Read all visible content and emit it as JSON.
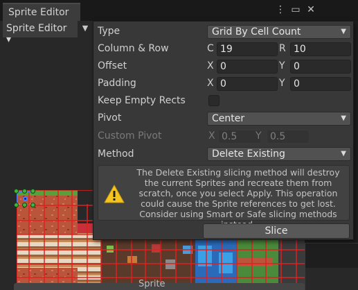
{
  "window": {
    "tab_title": "Sprite Editor"
  },
  "toolbar": {
    "mode_label": "Sprite Editor ▾"
  },
  "bottom": {
    "tab_label": "Sprite"
  },
  "slicing": {
    "type": {
      "label": "Type",
      "value": "Grid By Cell Count"
    },
    "column_row": {
      "label": "Column & Row",
      "c_label": "C",
      "c_value": "19",
      "r_label": "R",
      "r_value": "10"
    },
    "offset": {
      "label": "Offset",
      "x_label": "X",
      "x_value": "0",
      "y_label": "Y",
      "y_value": "0"
    },
    "padding": {
      "label": "Padding",
      "x_label": "X",
      "x_value": "0",
      "y_label": "Y",
      "y_value": "0"
    },
    "keep_empty": {
      "label": "Keep Empty Rects",
      "checked": false
    },
    "pivot": {
      "label": "Pivot",
      "value": "Center"
    },
    "custom_pivot": {
      "label": "Custom Pivot",
      "x_label": "X",
      "x_value": "0.5",
      "y_label": "Y",
      "y_value": "0.5"
    },
    "method": {
      "label": "Method",
      "value": "Delete Existing"
    },
    "help_text": "The Delete Existing slicing method will destroy the current Sprites and recreate them from scratch, once you select Apply. This operation could cause the Sprite references to get lost. Consider using Smart or Safe slicing methods instead.",
    "slice_button": "Slice"
  },
  "colors": {
    "grid_lines": "#e02020",
    "warning": "#f5c51e",
    "selection": "#4d7dff"
  }
}
